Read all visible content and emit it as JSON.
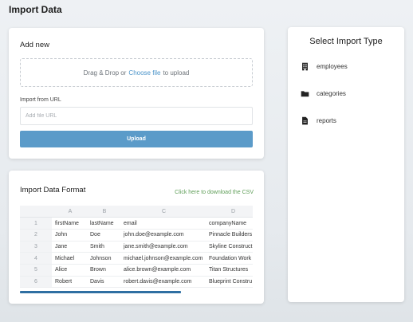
{
  "page": {
    "title": "Import Data"
  },
  "add_new": {
    "title": "Add new",
    "dropzone": {
      "prefix": "Drag & Drop or",
      "link": "Choose file",
      "suffix": "to upload"
    },
    "import_url": {
      "label": "Import from URL",
      "value": "",
      "placeholder": "Add file URL"
    },
    "upload_label": "Upload"
  },
  "format": {
    "title": "Import Data Format",
    "download_label": "Click here to download the CSV",
    "columns": [
      "A",
      "B",
      "C",
      "D"
    ],
    "rows": [
      {
        "num": "1",
        "cells": [
          "firstName",
          "lastName",
          "email",
          "companyName"
        ]
      },
      {
        "num": "2",
        "cells": [
          "John",
          "Doe",
          "john.doe@example.com",
          "Pinnacle Builders"
        ]
      },
      {
        "num": "3",
        "cells": [
          "Jane",
          "Smith",
          "jane.smith@example.com",
          "Skyline Construct"
        ]
      },
      {
        "num": "4",
        "cells": [
          "Michael",
          "Johnson",
          "michael.johnson@example.com",
          "Foundation Work"
        ]
      },
      {
        "num": "5",
        "cells": [
          "Alice",
          "Brown",
          "alice.brown@example.com",
          "Titan Structures"
        ]
      },
      {
        "num": "6",
        "cells": [
          "Robert",
          "Davis",
          "robert.davis@example.com",
          "Blueprint Constru"
        ]
      }
    ]
  },
  "import_type": {
    "title": "Select Import Type",
    "items": [
      {
        "label": "employees",
        "icon": "building-icon"
      },
      {
        "label": "categories",
        "icon": "folder-icon"
      },
      {
        "label": "reports",
        "icon": "file-icon"
      }
    ]
  },
  "colors": {
    "accent": "#5b9bc9",
    "link": "#4b94c9",
    "download_link": "#5f9e58",
    "scrollbar": "#2f6fa2"
  }
}
